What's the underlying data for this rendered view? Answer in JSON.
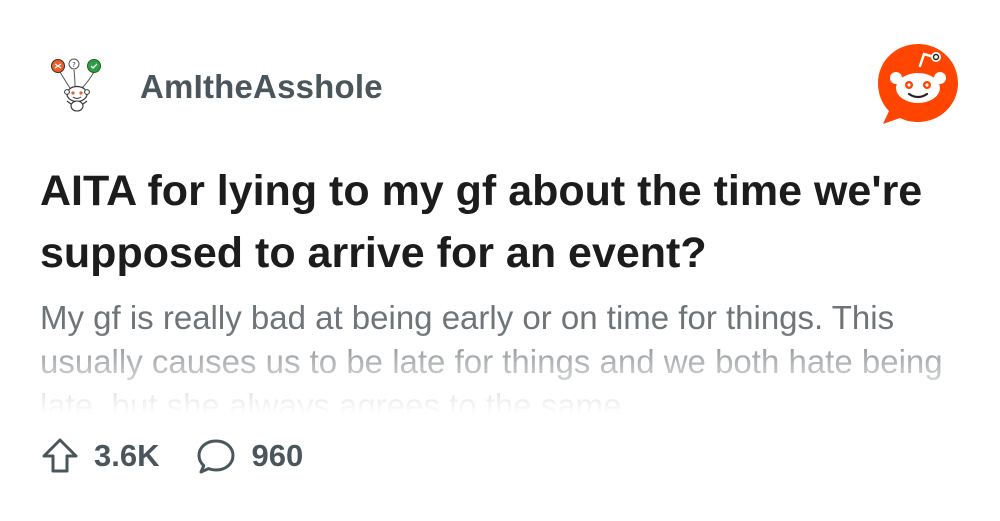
{
  "subreddit": {
    "name": "AmItheAsshole",
    "avatar_icon": "snoo-with-balloons-icon"
  },
  "brand": {
    "logo_icon": "reddit-logo-icon",
    "color": "#ff4500"
  },
  "post": {
    "title": "AITA for lying to my gf about the time we're supposed to arrive for an event?",
    "body": "My gf is really bad at being early or on time for things. This usually causes us to be late for things and we both hate being late, but she always agrees to the same"
  },
  "stats": {
    "upvotes": "3.6K",
    "upvote_icon": "upvote-arrow-icon",
    "comments": "960",
    "comment_icon": "comment-bubble-icon"
  }
}
